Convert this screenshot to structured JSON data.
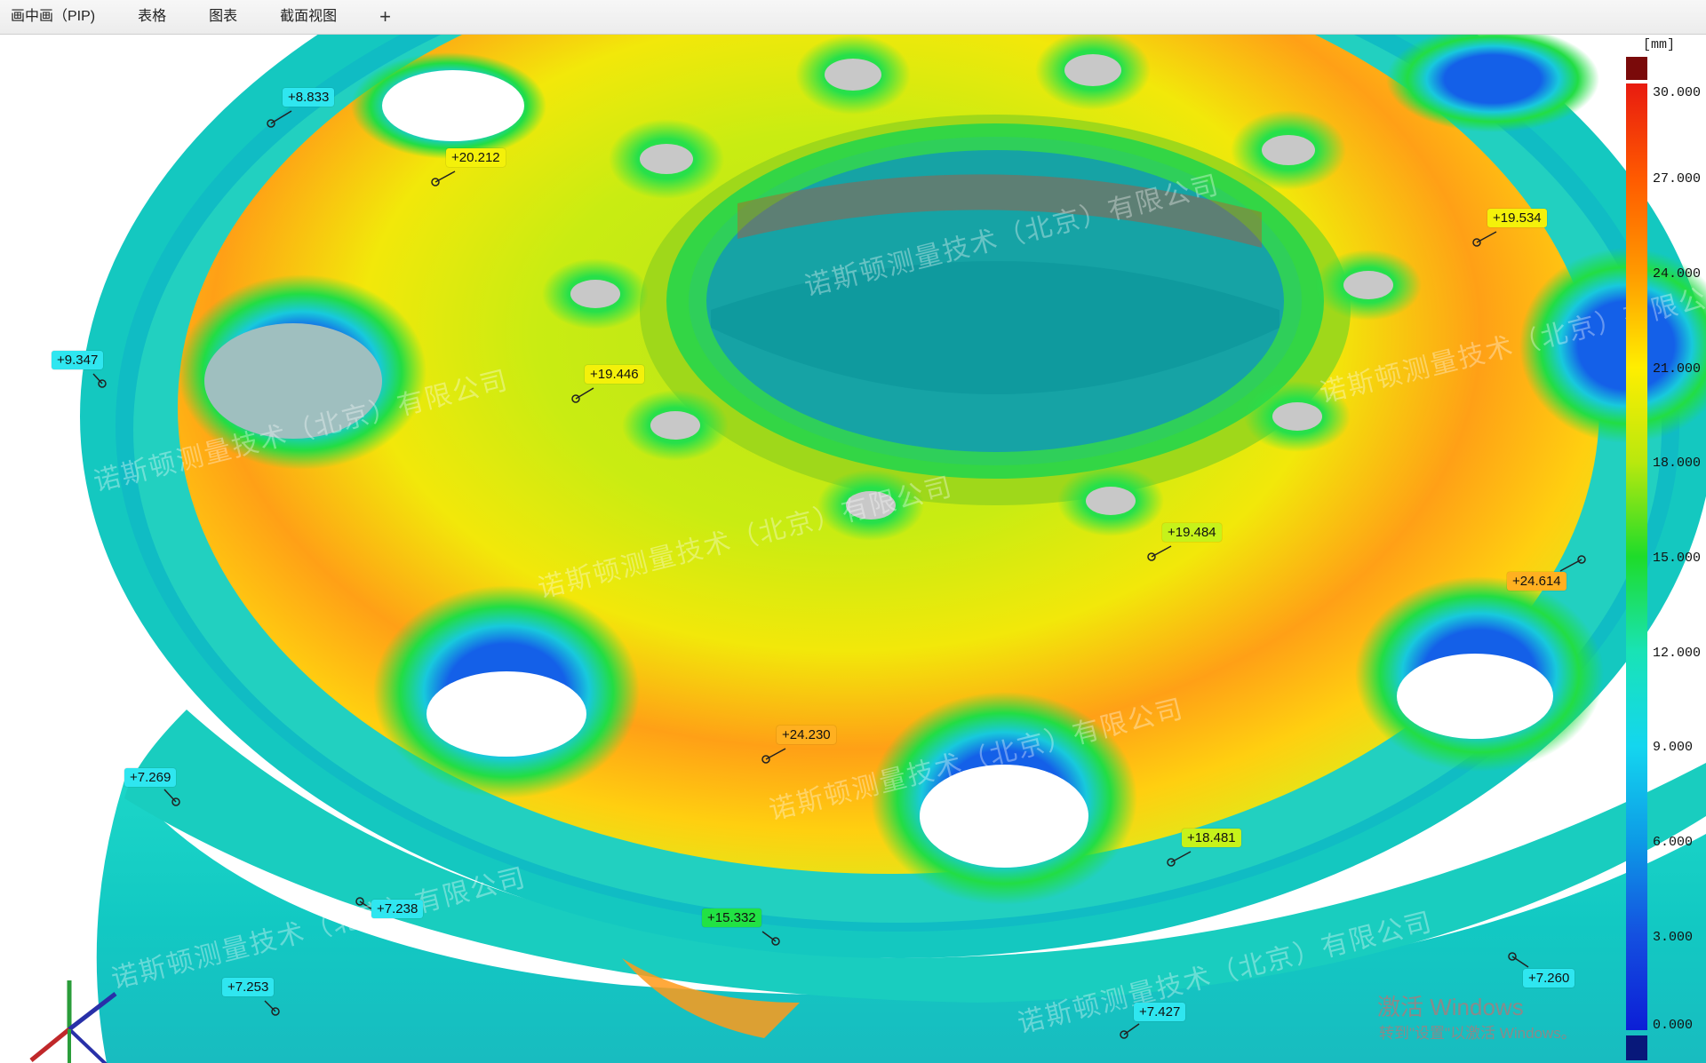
{
  "tabs": [
    {
      "label": "画中画（PIP)"
    },
    {
      "label": "表格"
    },
    {
      "label": "图表"
    },
    {
      "label": "截面视图"
    }
  ],
  "tab_add": "+",
  "legend": {
    "unit": "[mm]",
    "ticks": [
      "30.000",
      "27.000",
      "24.000",
      "21.000",
      "18.000",
      "15.000",
      "12.000",
      "9.000",
      "6.000",
      "3.000",
      "0.000"
    ],
    "colors": [
      "#7a0a0a",
      "#e81b10",
      "#ff8a00",
      "#ffee00",
      "#b9e80e",
      "#1edc2a",
      "#19e3b5",
      "#14d6ef",
      "#0d9be6",
      "#1450e0",
      "#0c1ed6",
      "#08187a"
    ]
  },
  "annotations": [
    {
      "value": "+8.833",
      "color": "cyan"
    },
    {
      "value": "+20.212",
      "color": "yellow"
    },
    {
      "value": "+9.347",
      "color": "cyan"
    },
    {
      "value": "+19.446",
      "color": "yellow"
    },
    {
      "value": "+19.534",
      "color": "yellow"
    },
    {
      "value": "+19.484",
      "color": "lime"
    },
    {
      "value": "+24.614",
      "color": "orange"
    },
    {
      "value": "+24.230",
      "color": "orange"
    },
    {
      "value": "+7.269",
      "color": "cyan"
    },
    {
      "value": "+18.481",
      "color": "lime"
    },
    {
      "value": "+7.238",
      "color": "cyan"
    },
    {
      "value": "+15.332",
      "color": "green"
    },
    {
      "value": "+7.253",
      "color": "cyan"
    },
    {
      "value": "+7.427",
      "color": "cyan"
    },
    {
      "value": "+7.260",
      "color": "cyan"
    }
  ],
  "watermark": {
    "company": "诺斯顿测量技术（北京）有限公司",
    "windows_line1": "激活 Windows",
    "windows_line2": "转到\"设置\"以激活 Windows。"
  },
  "axes": {
    "x": "X",
    "y": "Y",
    "z": "Z"
  }
}
